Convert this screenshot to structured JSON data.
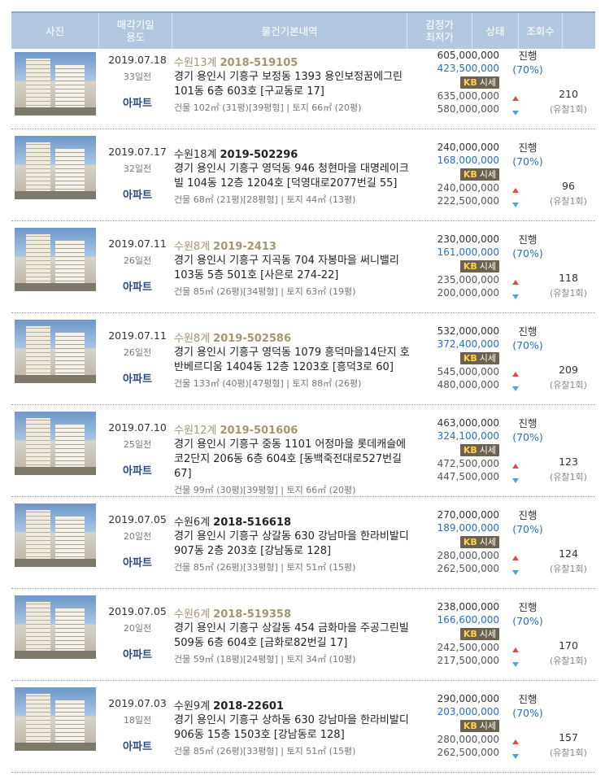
{
  "header": {
    "photo": "사진",
    "date_line1": "매각기일",
    "date_line2": "용도",
    "detail": "물건기본내역",
    "price_line1": "감정가",
    "price_line2": "최저가",
    "status": "상태",
    "views": "조회수"
  },
  "sise_label": "시세",
  "sise_prefix": "KB",
  "rows": [
    {
      "date": "2019.07.18",
      "ago": "33일전",
      "use": "아파트",
      "court": "수원13계",
      "court_gold": true,
      "case_no": "2018-519105",
      "num_gold": true,
      "addr": "경기 용인시 기흥구 보정동 1393 용인보정꿈에그린 101동 6층 603호 [구교동로 17]",
      "area": "건물 102㎡ (31평)[39평형] | 토지 66㎡ (20평)",
      "appraisal": "605,000,000",
      "minimum": "423,500,000",
      "kb_high": "635,000,000",
      "kb_low": "580,000,000",
      "status": "진행",
      "pct": "(70%)",
      "views": "210",
      "bids": "(유찰1회)"
    },
    {
      "date": "2019.07.17",
      "ago": "32일전",
      "use": "아파트",
      "court": "수원18계",
      "court_gold": false,
      "case_no": "2019-502296",
      "num_gold": false,
      "addr": "경기 용인시 기흥구 영덕동 946 청현마을 대명레이크빌 104동 12층 1204호 [덕영대로2077번길 55]",
      "area": "건물 68㎡ (21평)[28평형] | 토지 44㎡ (13평)",
      "appraisal": "240,000,000",
      "minimum": "168,000,000",
      "kb_high": "240,000,000",
      "kb_low": "222,500,000",
      "status": "진행",
      "pct": "(70%)",
      "views": "96",
      "bids": "(유찰1회)"
    },
    {
      "date": "2019.07.11",
      "ago": "26일전",
      "use": "아파트",
      "court": "수원8계",
      "court_gold": true,
      "case_no": "2019-2413",
      "num_gold": true,
      "addr": "경기 용인시 기흥구 지곡동 704 자봉마을 써니밸리 103동 5층 501호 [사은로 274-22]",
      "area": "건물 85㎡ (26평)[34평형] | 토지 63㎡ (19평)",
      "appraisal": "230,000,000",
      "minimum": "161,000,000",
      "kb_high": "235,000,000",
      "kb_low": "200,000,000",
      "status": "진행",
      "pct": "(70%)",
      "views": "118",
      "bids": "(유찰1회)"
    },
    {
      "date": "2019.07.11",
      "ago": "26일전",
      "use": "아파트",
      "court": "수원8계",
      "court_gold": true,
      "case_no": "2019-502586",
      "num_gold": true,
      "addr": "경기 용인시 기흥구 영덕동 1079 흥덕마을14단지 호반베르디움 1404동 12층 1203호 [흥덕3로 60]",
      "area": "건물 133㎡ (40평)[47평형] | 토지 88㎡ (26평)",
      "appraisal": "532,000,000",
      "minimum": "372,400,000",
      "kb_high": "545,000,000",
      "kb_low": "480,000,000",
      "status": "진행",
      "pct": "(70%)",
      "views": "209",
      "bids": "(유찰1회)"
    },
    {
      "date": "2019.07.10",
      "ago": "25일전",
      "use": "아파트",
      "court": "수원12계",
      "court_gold": true,
      "case_no": "2019-501606",
      "num_gold": true,
      "addr": "경기 용인시 기흥구 중동 1101 어정마을 롯데캐슬에코2단지 206동 6층 604호 [동백죽전대로527번길 67]",
      "area": "건물 99㎡ (30평)[39평형] | 토지 66㎡ (20평)",
      "appraisal": "463,000,000",
      "minimum": "324,100,000",
      "kb_high": "472,500,000",
      "kb_low": "447,500,000",
      "status": "진행",
      "pct": "(70%)",
      "views": "123",
      "bids": "(유찰1회)"
    },
    {
      "date": "2019.07.05",
      "ago": "20일전",
      "use": "아파트",
      "court": "수원6계",
      "court_gold": false,
      "case_no": "2018-516618",
      "num_gold": false,
      "addr": "경기 용인시 기흥구 상갈동 630 강남마을 한라비발디 907동 2층 203호 [강남동로 128]",
      "area": "건물 85㎡ (26평)[33평형] | 토지 51㎡ (15평)",
      "appraisal": "270,000,000",
      "minimum": "189,000,000",
      "kb_high": "280,000,000",
      "kb_low": "262,500,000",
      "status": "진행",
      "pct": "(70%)",
      "views": "124",
      "bids": "(유찰1회)"
    },
    {
      "date": "2019.07.05",
      "ago": "20일전",
      "use": "아파트",
      "court": "수원6계",
      "court_gold": true,
      "case_no": "2018-519358",
      "num_gold": true,
      "addr": "경기 용인시 기흥구 상갈동 454 금화마을 주공그린빌 509동 6층 604호 [금화로82번길 17]",
      "area": "건물 59㎡ (18평)[24평형] | 토지 34㎡ (10평)",
      "appraisal": "238,000,000",
      "minimum": "166,600,000",
      "kb_high": "242,500,000",
      "kb_low": "217,500,000",
      "status": "진행",
      "pct": "(70%)",
      "views": "170",
      "bids": "(유찰1회)"
    },
    {
      "date": "2019.07.03",
      "ago": "18일전",
      "use": "아파트",
      "court": "수원9계",
      "court_gold": false,
      "case_no": "2018-22601",
      "num_gold": false,
      "addr": "경기 용인시 기흥구 상하동 630 강남마을 한라비발디 906동 15층 1503호 [강남동로 128]",
      "area": "건물 85㎡ (26평)[33평형] | 토지 51㎡ (15평)",
      "appraisal": "290,000,000",
      "minimum": "203,000,000",
      "kb_high": "280,000,000",
      "kb_low": "262,500,000",
      "status": "진행",
      "pct": "(70%)",
      "views": "157",
      "bids": "(유찰1회)"
    }
  ]
}
